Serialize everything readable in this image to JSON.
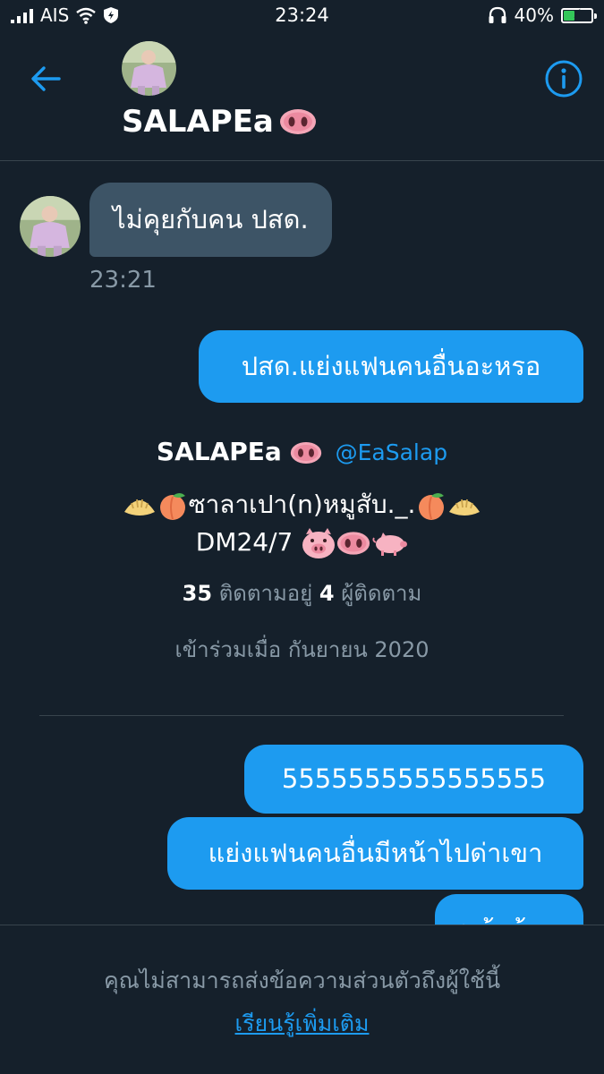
{
  "status_bar": {
    "carrier": "AIS",
    "time": "23:24",
    "battery_percent": "40%",
    "battery_level": 0.4
  },
  "header": {
    "back_icon": "arrow-left-icon",
    "display_name": "SALAPEa",
    "info_icon": "info-circle-icon"
  },
  "messages": [
    {
      "direction": "incoming",
      "text": "ไม่คุยกับคน ปสด.",
      "time": "23:21"
    },
    {
      "direction": "outgoing",
      "text": "ปสด.แย่งแฟนคนอื่นอะหรอ"
    },
    {
      "direction": "outgoing",
      "text": "5555555555555555"
    },
    {
      "direction": "outgoing",
      "text": "แย่งแฟนคนอื่นมีหน้าไปด่าเขา"
    },
    {
      "direction": "outgoing",
      "text": "หน้าด้าน"
    }
  ],
  "profile_card": {
    "name": "SALAPEa",
    "handle": "@EaSalap",
    "bio_line1": "ซาลาเปา(n)หมูสับ._.",
    "bio_line2": "DM24/7",
    "following_count": "35",
    "following_label": "ติดตามอยู่",
    "followers_count": "4",
    "followers_label": "ผู้ติดตาม",
    "joined": "เข้าร่วมเมื่อ กันยายน 2020"
  },
  "footer": {
    "notice": "คุณไม่สามารถส่งข้อความส่วนตัวถึงผู้ใช้นี้",
    "learn_more": "เรียนรู้เพิ่มเติม"
  },
  "colors": {
    "background": "#15202b",
    "accent": "#1d9bf0",
    "incoming_bubble": "#3d5466",
    "muted_text": "#8899a6",
    "divider": "#38444d"
  }
}
